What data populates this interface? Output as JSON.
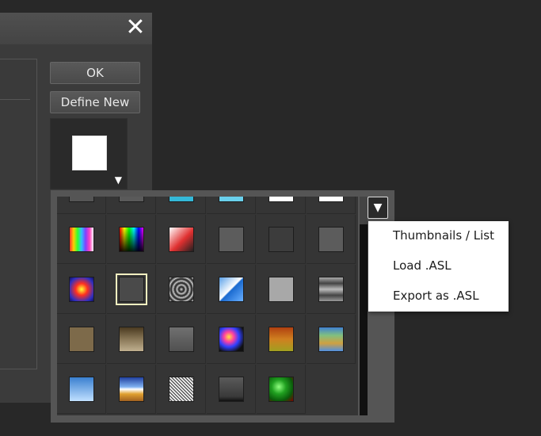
{
  "dialog": {
    "close_symbol": "✕",
    "ok_label": "OK",
    "define_new_label": "Define New",
    "preview_caret": "▼"
  },
  "picker": {
    "menu_button_symbol": "▼",
    "items": [
      {
        "name": "Partial row 1",
        "bg": "#555555"
      },
      {
        "name": "Partial row 2",
        "bg": "#5a5a5a"
      },
      {
        "name": "Partial row 3",
        "bg": "#34b8d8"
      },
      {
        "name": "Partial row 4",
        "bg": "#6ad0ec"
      },
      {
        "name": "Partial row 5",
        "bg": "#ffffff"
      },
      {
        "name": "Partial row 6",
        "bg": "#ffffff"
      },
      {
        "name": "Spectrum stripes",
        "bg": "linear-gradient(90deg,#ff3030,#ffd000,#30ff30,#30c0ff,#8040ff,#ff40c0,#ffffff)"
      },
      {
        "name": "Color spectrum",
        "bg": "linear-gradient(to bottom, rgba(255,255,255,0) 0%, rgba(0,0,0,0.9) 100%), linear-gradient(90deg,#ff0000,#ffff00,#00ff00,#00ffff,#0000ff,#ff00ff)"
      },
      {
        "name": "Red to white",
        "bg": "linear-gradient(135deg,#ffffff 0%,#e03030 55%,#202020 100%)"
      },
      {
        "name": "Gray bevel",
        "bg": "#5c5c5c"
      },
      {
        "name": "Dark bevel",
        "bg": "#3c3c3c"
      },
      {
        "name": "Gray bevel 2",
        "bg": "#5c5c5c"
      },
      {
        "name": "Radial heat",
        "bg": "radial-gradient(circle,#ffff30 0%,#ff3020 35%,#3030c0 75%,#101060 100%)"
      },
      {
        "name": "Outline gray",
        "bg": "#4a4a4a"
      },
      {
        "name": "Concentric rings",
        "bg": "repeating-radial-gradient(circle,#e0e0e0 0px,#202020 3px,#808080 5px)"
      },
      {
        "name": "Blue diagonal",
        "bg": "linear-gradient(135deg,#5aa0e8 0%,#ffffff 48%,#1a6ad0 52%,#6ab0ff 100%)"
      },
      {
        "name": "Light gray",
        "bg": "#a8a8a8"
      },
      {
        "name": "Chrome pattern",
        "bg": "linear-gradient(180deg,#aaaaaa,#444444,#bbbbbb,#444444,#999999)"
      },
      {
        "name": "Khaki",
        "bg": "#7d6a4a"
      },
      {
        "name": "Bronze gradient",
        "bg": "linear-gradient(#4a3a20,#8a7858,#c0b090)"
      },
      {
        "name": "Slate gray",
        "bg": "linear-gradient(#707070,#505050)"
      },
      {
        "name": "Psychedelic",
        "bg": "radial-gradient(circle at 40% 40%,#ffe040 0%,#ff40a0 25%,#3040ff 50%,#101010 80%)"
      },
      {
        "name": "Orange rust",
        "bg": "linear-gradient(#b04010,#d08020,#a0a020)"
      },
      {
        "name": "Blue green wave",
        "bg": "linear-gradient(#4080d0,#80c080,#d0a040,#5090e0)"
      },
      {
        "name": "Sky",
        "bg": "linear-gradient(#3a80d0,#c0e0ff)"
      },
      {
        "name": "Sunset landscape",
        "bg": "linear-gradient(#2040a0 0%,#80b0f0 40%,#ffffff 50%,#e0a030 70%,#a06020 100%)"
      },
      {
        "name": "Noise",
        "bg": "repeating-linear-gradient(45deg,#ffffff 0px,#ffffff 1px,#303030 2px,#aaaaaa 3px)"
      },
      {
        "name": "Gray shadow",
        "bg": "linear-gradient(#5a5a5a,#3a3a3a 80%,#101010)"
      },
      {
        "name": "Green sphere",
        "bg": "radial-gradient(circle at 40% 40%,#90ff80 0%,#20a020 35%,#0a5a0a 70%,#800000 100%)"
      }
    ]
  },
  "menu": {
    "items": [
      "Thumbnails / List",
      "Load .ASL",
      "Export as .ASL"
    ]
  }
}
